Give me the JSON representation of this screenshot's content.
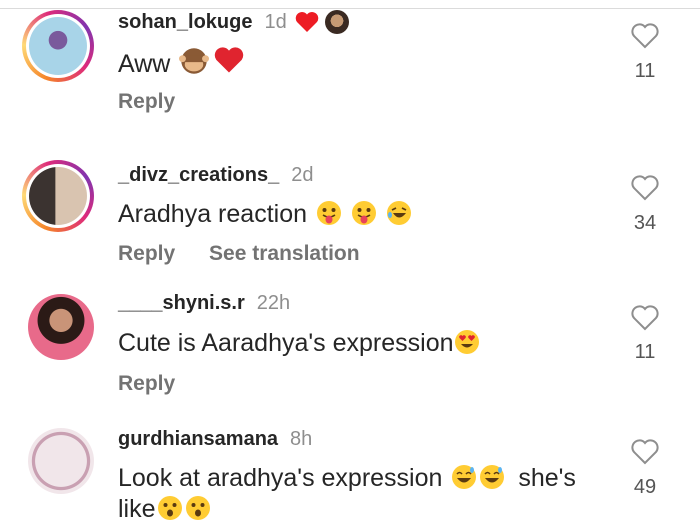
{
  "comments": [
    {
      "username": "sohan_lokuge",
      "time": "1d",
      "text": "Aww",
      "emojis_after": [
        "see-no-evil-monkey-icon",
        "red-heart-icon"
      ],
      "actions": [
        "Reply"
      ],
      "likes": "11",
      "reply_badges": [
        "red-heart-icon",
        "creator-avatar"
      ]
    },
    {
      "username": "_divz_creations_",
      "time": "2d",
      "text": "Aradhya reaction",
      "emojis_after": [
        "tongue-out-face-icon",
        "tongue-out-face-icon",
        "rolling-laughing-face-icon"
      ],
      "actions": [
        "Reply",
        "See translation"
      ],
      "likes": "34"
    },
    {
      "username": "____shyni.s.r",
      "time": "22h",
      "text": "Cute is Aaradhya's expression",
      "emojis_after": [
        "heart-eyes-face-icon"
      ],
      "actions": [
        "Reply"
      ],
      "likes": "11"
    },
    {
      "username": "gurdhiansamana",
      "time": "8h",
      "text_line1": "Look at aradhya's expression",
      "text_line1_after": "she's",
      "text_line2": "like",
      "emojis_mid": [
        "grinning-sweat-face-icon",
        "grinning-sweat-face-icon"
      ],
      "emojis_after": [
        "hushed-face-icon",
        "hushed-face-icon"
      ],
      "likes": "49"
    }
  ],
  "colors": {
    "text": "#262626",
    "secondary": "#8e8e8e",
    "heart_red": "#ed4956"
  }
}
